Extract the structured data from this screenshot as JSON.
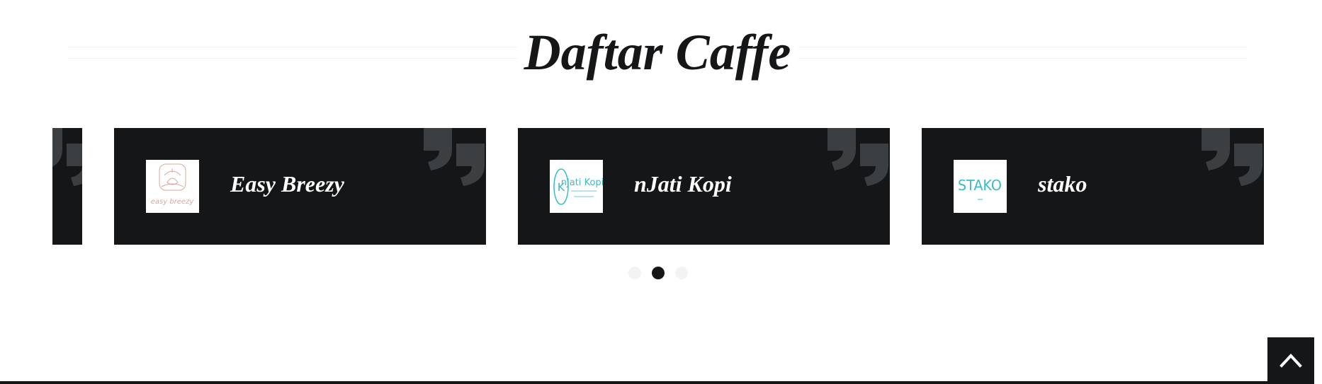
{
  "header": {
    "title": "Daftar Caffe"
  },
  "carousel": {
    "cards": [
      {
        "name": "",
        "logo_text": ""
      },
      {
        "name": "Easy Breezy",
        "logo_text": "easy breezy"
      },
      {
        "name": "nJati Kopi",
        "logo_text": "nJati Kopi"
      },
      {
        "name": "stako",
        "logo_text": "STAKO"
      }
    ],
    "active_page": 2,
    "page_count": 3
  },
  "icons": {
    "quote": "quote-mark-icon",
    "scroll_top": "chevron-up-icon"
  },
  "colors": {
    "card_bg": "#141618",
    "quote_mark": "#3c3f42",
    "dot_active": "#141618",
    "dot_inactive": "#f3f3f3",
    "easy_breezy_logo": "#d9a7a0",
    "njati_logo": "#3bbcc4",
    "stako_logo": "#3bbcc4"
  }
}
